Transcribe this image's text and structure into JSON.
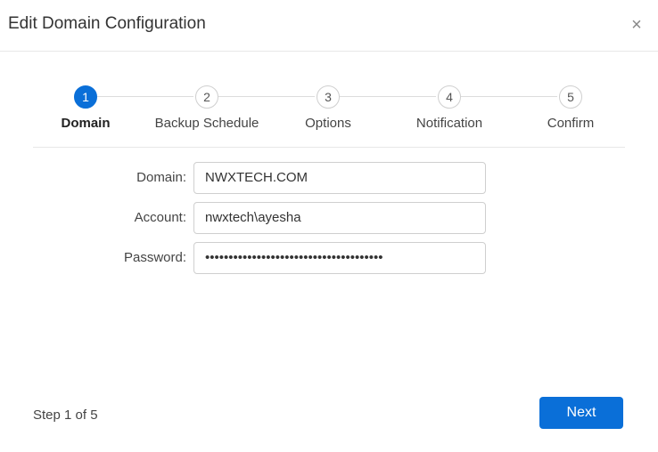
{
  "dialog": {
    "title": "Edit Domain Configuration",
    "close_label": "×"
  },
  "steps": [
    {
      "number": "1",
      "label": "Domain",
      "active": true
    },
    {
      "number": "2",
      "label": "Backup Schedule",
      "active": false
    },
    {
      "number": "3",
      "label": "Options",
      "active": false
    },
    {
      "number": "4",
      "label": "Notification",
      "active": false
    },
    {
      "number": "5",
      "label": "Confirm",
      "active": false
    }
  ],
  "form": {
    "domain": {
      "label": "Domain:",
      "value": "NWXTECH.COM"
    },
    "account": {
      "label": "Account:",
      "value": "nwxtech\\ayesha"
    },
    "password": {
      "label": "Password:",
      "value": "••••••••••••••••••••••••••••••••••••••"
    }
  },
  "footer": {
    "step_indicator": "Step 1 of 5",
    "next_label": "Next"
  },
  "colors": {
    "accent": "#0a6fd8",
    "border": "#cfcfcf",
    "divider": "#e8e8e8"
  }
}
